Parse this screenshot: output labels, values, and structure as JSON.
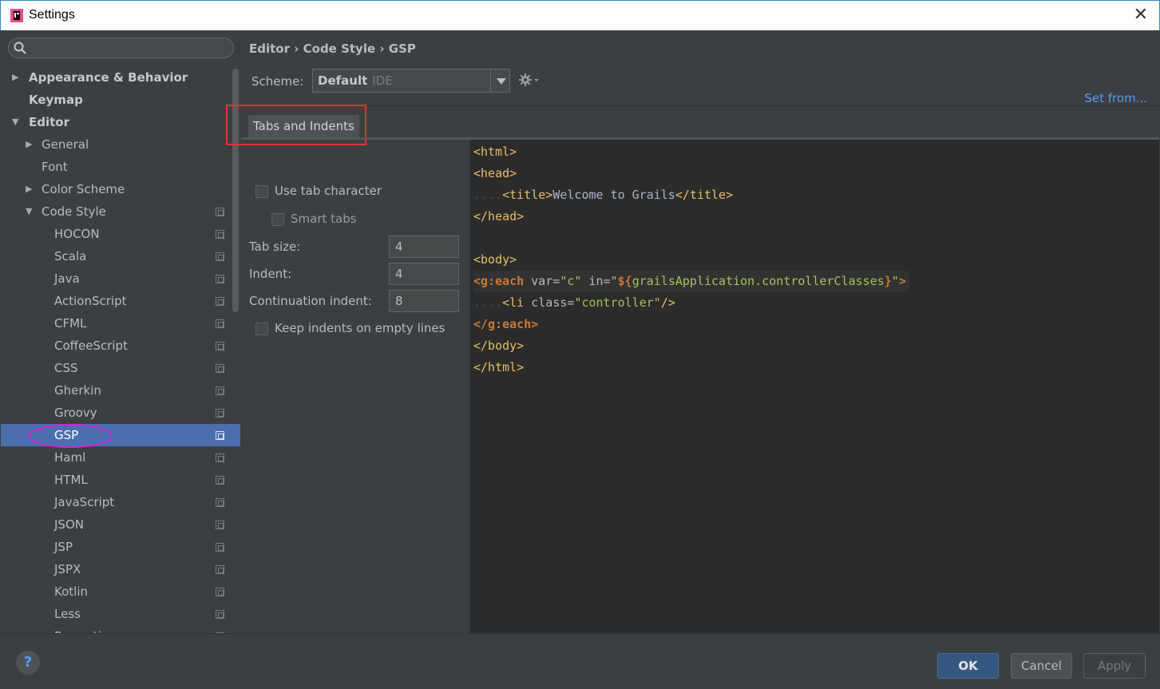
{
  "window": {
    "title": "Settings"
  },
  "sidebar": {
    "items": [
      {
        "label": "Appearance & Behavior",
        "level": 0,
        "bold": true,
        "arrow": "right"
      },
      {
        "label": "Keymap",
        "level": 0,
        "bold": true
      },
      {
        "label": "Editor",
        "level": 0,
        "bold": true,
        "arrow": "down"
      },
      {
        "label": "General",
        "level": 1,
        "arrow": "right"
      },
      {
        "label": "Font",
        "level": 1
      },
      {
        "label": "Color Scheme",
        "level": 1,
        "arrow": "right"
      },
      {
        "label": "Code Style",
        "level": 1,
        "arrow": "down",
        "copy": true
      },
      {
        "label": "HOCON",
        "level": 2,
        "copy": true
      },
      {
        "label": "Scala",
        "level": 2,
        "copy": true
      },
      {
        "label": "Java",
        "level": 2,
        "copy": true
      },
      {
        "label": "ActionScript",
        "level": 2,
        "copy": true
      },
      {
        "label": "CFML",
        "level": 2,
        "copy": true
      },
      {
        "label": "CoffeeScript",
        "level": 2,
        "copy": true
      },
      {
        "label": "CSS",
        "level": 2,
        "copy": true
      },
      {
        "label": "Gherkin",
        "level": 2,
        "copy": true
      },
      {
        "label": "Groovy",
        "level": 2,
        "copy": true
      },
      {
        "label": "GSP",
        "level": 2,
        "copy": true,
        "selected": true
      },
      {
        "label": "Haml",
        "level": 2,
        "copy": true
      },
      {
        "label": "HTML",
        "level": 2,
        "copy": true
      },
      {
        "label": "JavaScript",
        "level": 2,
        "copy": true
      },
      {
        "label": "JSON",
        "level": 2,
        "copy": true
      },
      {
        "label": "JSP",
        "level": 2,
        "copy": true
      },
      {
        "label": "JSPX",
        "level": 2,
        "copy": true
      },
      {
        "label": "Kotlin",
        "level": 2,
        "copy": true
      },
      {
        "label": "Less",
        "level": 2,
        "copy": true
      },
      {
        "label": "Properties",
        "level": 2,
        "copy": true
      }
    ]
  },
  "header": {
    "breadcrumb": "Editor › Code Style › GSP",
    "scheme_label": "Scheme:",
    "scheme_value": "Default",
    "scheme_sub": "IDE",
    "set_from": "Set from..."
  },
  "tabs": [
    {
      "label": "Tabs and Indents",
      "active": true
    }
  ],
  "options": {
    "use_tab_character": "Use tab character",
    "smart_tabs": "Smart tabs",
    "tab_size_label": "Tab size:",
    "tab_size_value": "4",
    "indent_label": "Indent:",
    "indent_value": "4",
    "continuation_label": "Continuation indent:",
    "continuation_value": "8",
    "keep_indents": "Keep indents on empty lines"
  },
  "preview": {
    "l1": "<html>",
    "l2": "<head>",
    "l3_indent": "....",
    "l3_open": "<title>",
    "l3_text": "Welcome to Grails",
    "l3_close": "</title>",
    "l4": "</head>",
    "l6": "<body>",
    "l7_open": "<g:each",
    "l7_var": " var=",
    "l7_var_val": "\"c\"",
    "l7_in": " in=",
    "l7_in_q": "\"",
    "l7_expr": "${",
    "l7_expr_body": "grailsApplication.controllerClasses",
    "l7_expr_end": "}",
    "l7_end_q": "\"",
    "l7_gt": ">",
    "l8_indent": "....",
    "l8_open": "<li",
    "l8_class": " class=",
    "l8_class_val": "\"controller\"",
    "l8_close": "/>",
    "l9": "</g:each>",
    "l10": "</body>",
    "l11": "</html>"
  },
  "footer": {
    "help": "?",
    "ok": "OK",
    "cancel": "Cancel",
    "apply": "Apply"
  }
}
